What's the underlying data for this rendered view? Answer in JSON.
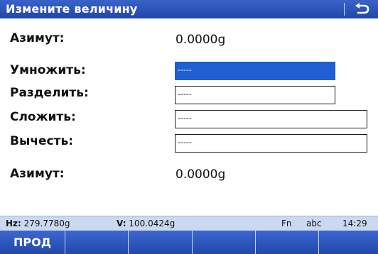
{
  "window": {
    "title": "Измените величину"
  },
  "icons": {
    "back": "back-arrow-icon"
  },
  "rows": {
    "azimuth_top": {
      "label": "Азимут:",
      "value": "0.0000g"
    },
    "multiply": {
      "label": "Умножить:",
      "value": "-----"
    },
    "divide": {
      "label": "Разделить:",
      "value": "-----"
    },
    "add": {
      "label": "Сложить:",
      "value": "-----"
    },
    "subtract": {
      "label": "Вычесть:",
      "value": "-----"
    },
    "azimuth_bottom": {
      "label": "Азимут:",
      "value": "0.0000g"
    }
  },
  "status": {
    "hz_label": "Hz:",
    "hz_value": "279.7780g",
    "v_label": "V:",
    "v_value": "100.0424g",
    "fn": "Fn",
    "input_mode": "abc",
    "time": "14:29"
  },
  "softkeys": [
    "ПРОД",
    "",
    "",
    "",
    "",
    ""
  ],
  "colors": {
    "title_bg": "#2a52b8",
    "active_field": "#1f5fd1",
    "status_bg": "#cbd9f0"
  }
}
